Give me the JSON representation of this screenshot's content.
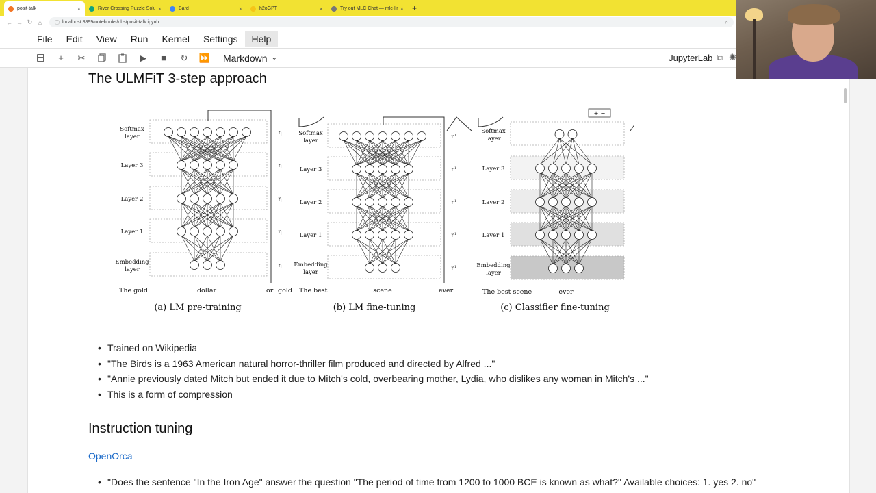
{
  "browser": {
    "tabs": [
      {
        "title": "posit-talk",
        "active": true,
        "color": "#f37626"
      },
      {
        "title": "River Crossing Puzzle Solution",
        "active": false,
        "color": "#10a37f"
      },
      {
        "title": "Bard",
        "active": false,
        "color": "#4285f4"
      },
      {
        "title": "h2oGPT",
        "active": false,
        "color": "#f5c518"
      },
      {
        "title": "Try out MLC Chat — mlc-llm 0...",
        "active": false,
        "color": "#777777"
      }
    ],
    "new_tab": "+",
    "url": "localhost:8899/notebooks/nbs/posit-talk.ipynb"
  },
  "menubar": {
    "items": [
      "File",
      "Edit",
      "View",
      "Run",
      "Kernel",
      "Settings",
      "Help"
    ]
  },
  "toolbar": {
    "cell_type": "Markdown",
    "app_name": "JupyterLab"
  },
  "section1": {
    "heading": "The ULMFiT 3-step approach",
    "bullets": [
      "Trained on Wikipedia",
      "\"The Birds is a 1963 American natural horror-thriller film produced and directed by Alfred ...\"",
      "\"Annie previously dated Mitch but ended it due to Mitch's cold, overbearing mother, Lydia, who dislikes any woman in Mitch's ...\"",
      "This is a form of compression"
    ]
  },
  "figure": {
    "captions": [
      "(a) LM pre-training",
      "(b) LM fine-tuning",
      "(c) Classifier fine-tuning"
    ],
    "layers": [
      "Softmax layer",
      "Layer 3",
      "Layer 2",
      "Layer 1",
      "Embedding layer"
    ],
    "panel_a_bottom": [
      "The gold",
      "dollar",
      "or",
      "gold"
    ],
    "panel_b_bottom": [
      "The best",
      "scene",
      "ever"
    ],
    "panel_c_bottom": [
      "The best scene",
      "ever"
    ]
  },
  "section2": {
    "heading": "Instruction tuning",
    "link": "OpenOrca",
    "bullets": [
      "\"Does the sentence \"In the Iron Age\" answer the question \"The period of time from 1200 to 1000 BCE is known as what?\" Available choices: 1. yes 2. no\""
    ]
  }
}
